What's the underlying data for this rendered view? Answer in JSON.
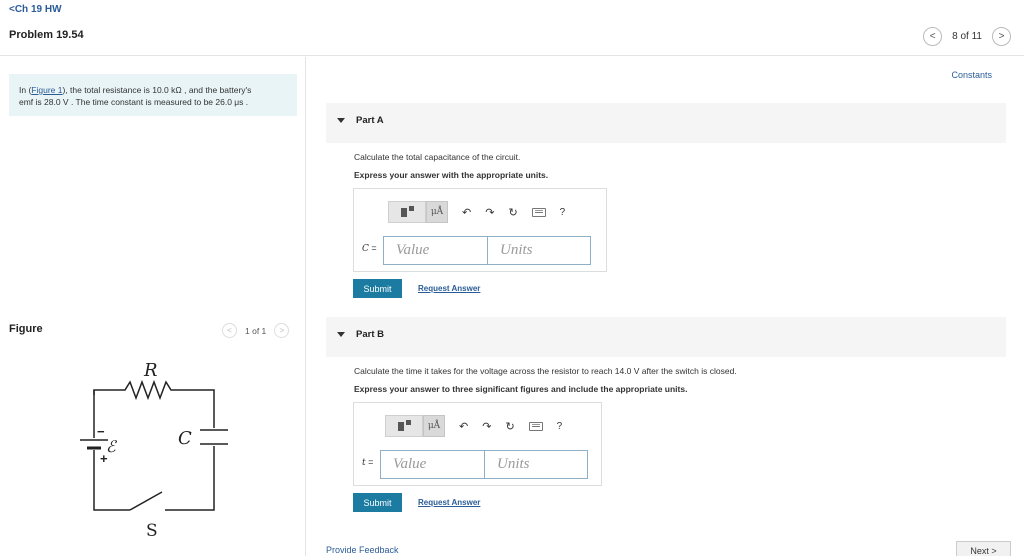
{
  "header": {
    "back_label": "<Ch 19 HW",
    "problem_title": "Problem 19.54",
    "pager_text": "8 of 11",
    "prev_glyph": "<",
    "next_glyph": ">"
  },
  "intro": {
    "line1_pre": "In (",
    "figure_link": "Figure 1",
    "line1_post": "), the total resistance is 10.0 kΩ , and the battery's",
    "line2": "emf is 28.0 V . The time constant is measured to be 26.0 μs ."
  },
  "figure": {
    "label": "Figure",
    "pager_text": "1 of 1",
    "resistor_label": "R",
    "emf_label": "ℰ",
    "capacitor_label": "C",
    "switch_label": "S",
    "plus": "+",
    "minus": "−"
  },
  "constants_link": "Constants",
  "parts": [
    {
      "title": "Part A",
      "question": "Calculate the total capacitance of the circuit.",
      "instruction": "Express your answer with the appropriate units.",
      "var_name": "C",
      "var_eq": " =",
      "value_placeholder": "Value",
      "units_placeholder": "Units",
      "submit": "Submit",
      "request": "Request Answer"
    },
    {
      "title": "Part B",
      "question": "Calculate the time it takes for the voltage across the resistor to reach 14.0 V after the switch is closed.",
      "instruction": "Express your answer to three significant figures and include the appropriate units.",
      "var_name": "t",
      "var_eq": " =",
      "value_placeholder": "Value",
      "units_placeholder": "Units",
      "submit": "Submit",
      "request": "Request Answer"
    }
  ],
  "toolbar": {
    "mu_label": "μÅ",
    "undo": "↶",
    "redo": "↷",
    "reset": "↻",
    "help": "?"
  },
  "footer": {
    "feedback": "Provide Feedback",
    "next": "Next >"
  }
}
